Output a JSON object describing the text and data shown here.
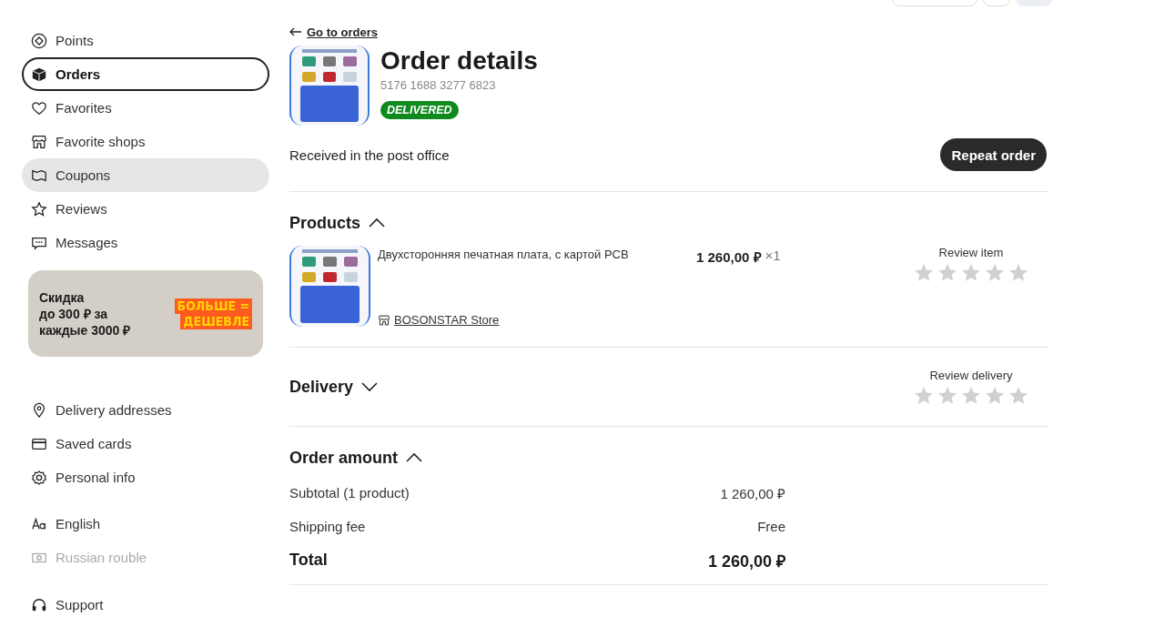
{
  "sidebar": {
    "menu": [
      {
        "label": "Points",
        "selected": false,
        "hovered": false
      },
      {
        "label": "Orders",
        "selected": true,
        "hovered": false
      },
      {
        "label": "Favorites",
        "selected": false,
        "hovered": false
      },
      {
        "label": "Favorite shops",
        "selected": false,
        "hovered": false
      },
      {
        "label": "Coupons",
        "selected": false,
        "hovered": true
      },
      {
        "label": "Reviews",
        "selected": false,
        "hovered": false
      },
      {
        "label": "Messages",
        "selected": false,
        "hovered": false
      }
    ],
    "banner": {
      "text_lines": [
        "Скидка",
        "до 300 ₽ за",
        "каждые 3000 ₽"
      ],
      "sticker_top": "БОЛЬШЕ =",
      "sticker_bottom": "ДЕШЕВЛЕ"
    },
    "account_menu": [
      {
        "label": "Delivery addresses"
      },
      {
        "label": "Saved cards"
      },
      {
        "label": "Personal info"
      }
    ],
    "preferences": [
      {
        "label": "English",
        "disabled": false
      },
      {
        "label": "Russian rouble",
        "disabled": true
      }
    ],
    "support": {
      "label": "Support"
    }
  },
  "order": {
    "back_link": "Go to orders",
    "title": "Order details",
    "number": "5176 1688 3277 6823",
    "status": "DELIVERED",
    "status_text": "Received in the post office",
    "repeat_button": "Repeat order"
  },
  "products": {
    "heading": "Products",
    "expanded": true,
    "items": [
      {
        "name": "Двухсторонняя печатная плата, с картой PCB",
        "price": "1 260,00 ₽",
        "quantity": "×1",
        "store": "BOSONSTAR Store",
        "review_label": "Review item",
        "stars": 0
      }
    ]
  },
  "delivery": {
    "heading": "Delivery",
    "expanded": false,
    "review_label": "Review delivery",
    "stars": 0
  },
  "order_amount": {
    "heading": "Order amount",
    "expanded": true,
    "rows": [
      {
        "kind": "line",
        "label": "Subtotal (1 product)",
        "value": "1 260,00 ₽"
      },
      {
        "kind": "line",
        "label": "Shipping fee",
        "value": "Free"
      },
      {
        "kind": "total",
        "label": "Total",
        "value": "1 260,00 ₽"
      }
    ]
  }
}
